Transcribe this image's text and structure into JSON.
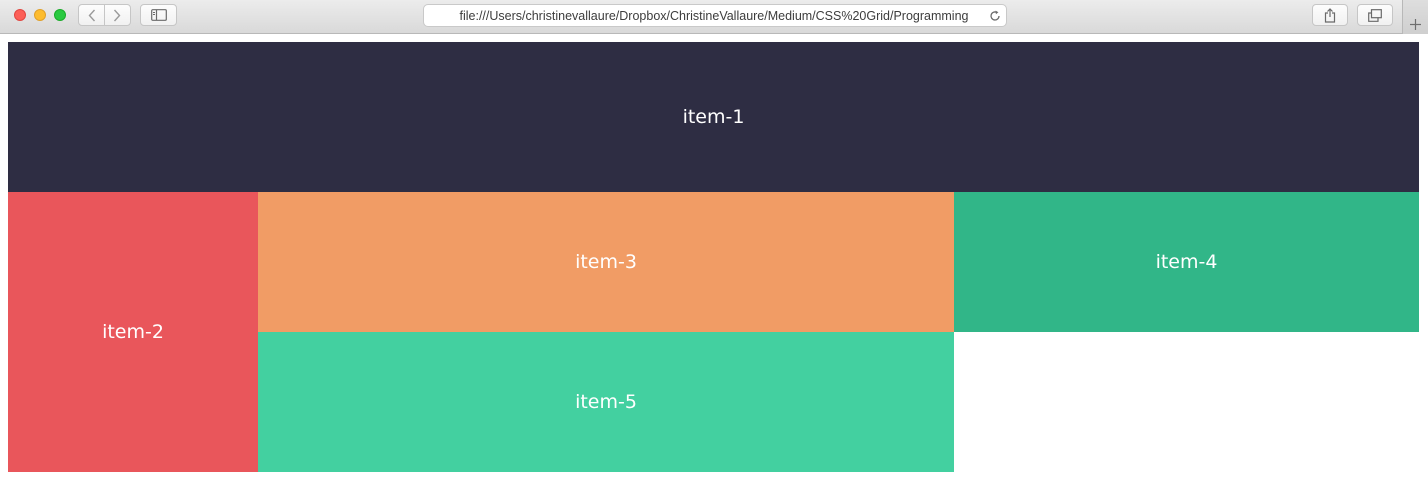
{
  "browser": {
    "url": "file:///Users/christinevallaure/Dropbox/ChristineVallaure/Medium/CSS%20Grid/Programming",
    "icons": {
      "back": "chevron-left-icon",
      "forward": "chevron-right-icon",
      "sidebar": "sidebar-icon",
      "reload": "reload-icon",
      "share": "share-icon",
      "tabs": "tabs-overview-icon",
      "new_tab": "plus-icon"
    }
  },
  "grid": {
    "items": [
      {
        "label": "item-1",
        "color": "#2e2d43"
      },
      {
        "label": "item-2",
        "color": "#e9565b"
      },
      {
        "label": "item-3",
        "color": "#f19c65"
      },
      {
        "label": "item-4",
        "color": "#31b688"
      },
      {
        "label": "item-5",
        "color": "#43d0a0"
      }
    ]
  }
}
